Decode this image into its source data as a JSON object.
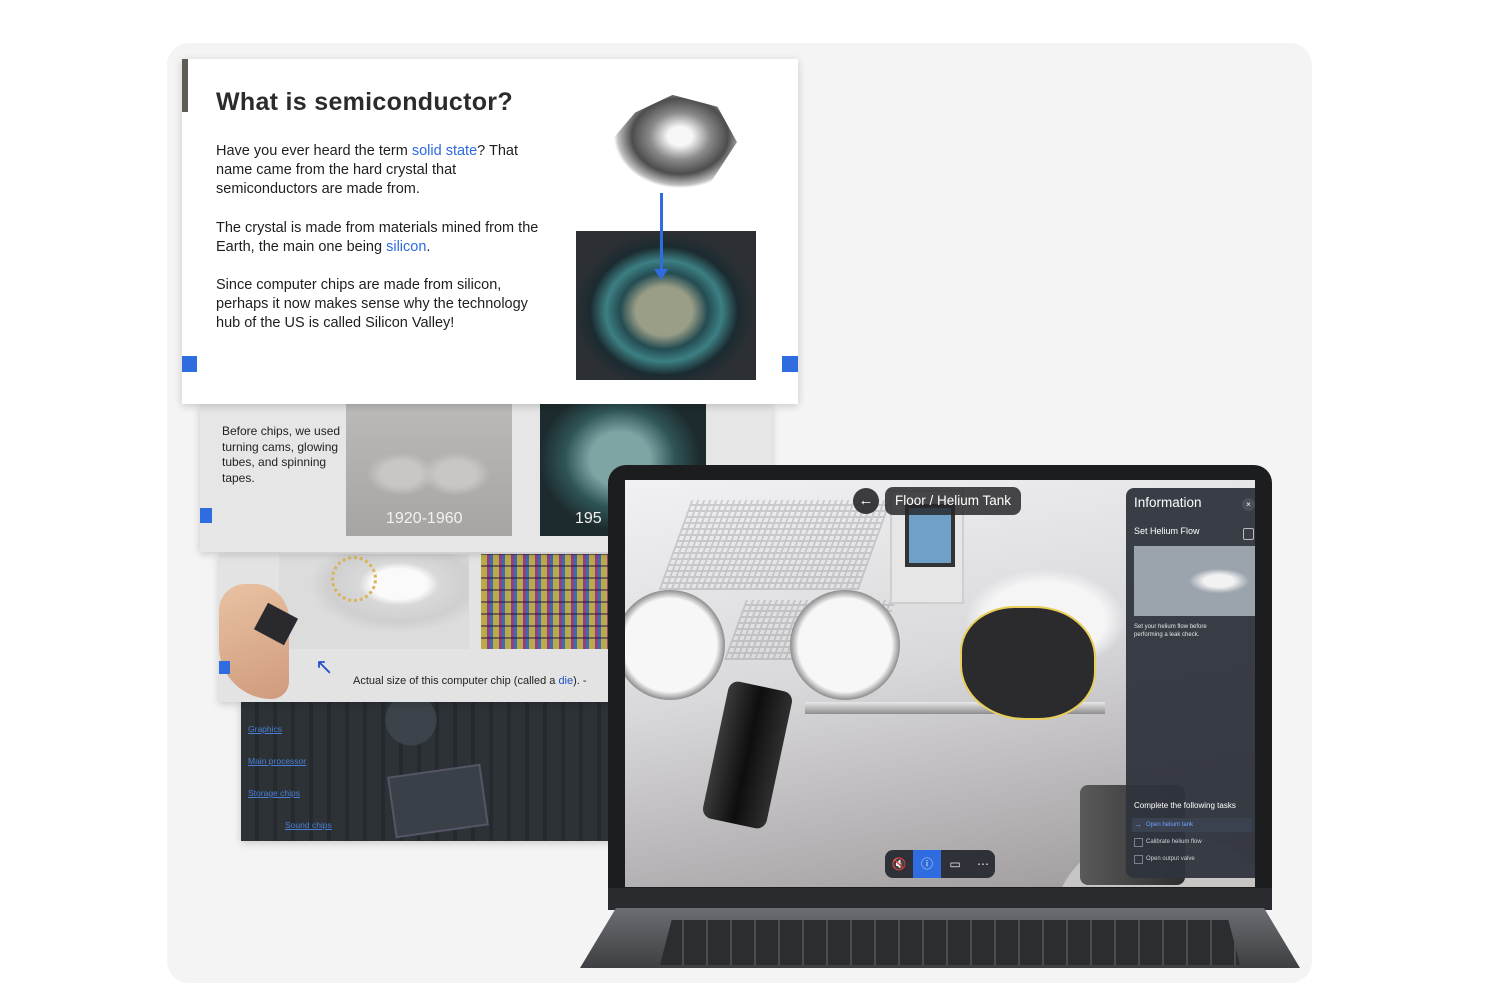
{
  "front_slide": {
    "title": "What is semiconductor?",
    "p1_before": "Have you ever heard the term ",
    "p1_keyword": "solid state",
    "p1_after": "? That name came from the hard crystal that semiconductors are made from.",
    "p2_before": "The crystal is made from materials mined from the Earth, the main one being ",
    "p2_keyword": "silicon",
    "p2_after": ".",
    "p3": "Since computer chips are made from silicon, perhaps it now makes sense why the technology hub of the US is called Silicon Valley!"
  },
  "history_slide": {
    "text": "Before chips, we used turning cams, glowing tubes, and spinning tapes.",
    "year1": "1920-1960",
    "year2": "195"
  },
  "die_slide": {
    "caption_before": "Actual size of this computer chip (called a ",
    "caption_keyword": "die",
    "caption_after": "). -"
  },
  "board_slide": {
    "labels": [
      "Graphics",
      "Main processor",
      "Storage chips",
      "Sound chips"
    ]
  },
  "simulation": {
    "back_icon": "arrow-left-icon",
    "breadcrumb": "Floor / Helium Tank",
    "toolbar": [
      "mute-icon",
      "info-icon",
      "screen-icon",
      "more-icon"
    ],
    "info_panel": {
      "title": "Information",
      "close_icon": "close-icon",
      "step_title": "Set Helium Flow",
      "bookmark_icon": "bookmark-icon",
      "description": "Set your helium flow before performing a leak check.",
      "tasks_title": "Complete the following tasks",
      "tasks": [
        {
          "label": "Open helium tank",
          "state": "active"
        },
        {
          "label": "Calibrate helium flow",
          "state": "pending"
        },
        {
          "label": "Open output valve",
          "state": "pending"
        }
      ]
    }
  },
  "colors": {
    "accent": "#2f6ce0",
    "keyword": "#2c6ae0",
    "highlight_outline": "#e8cf5a"
  }
}
